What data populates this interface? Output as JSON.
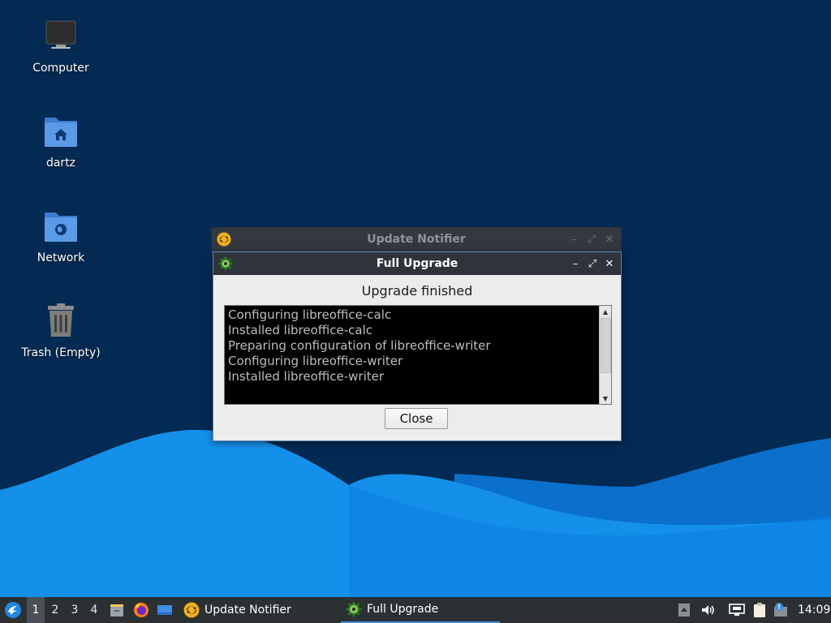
{
  "desktop": {
    "icons": [
      {
        "label": "Computer",
        "icon": "computer-icon"
      },
      {
        "label": "dartz",
        "icon": "home-folder-icon"
      },
      {
        "label": "Network",
        "icon": "network-folder-icon"
      },
      {
        "label": "Trash (Empty)",
        "icon": "trash-icon"
      }
    ]
  },
  "background_window": {
    "title": "Update Notifier",
    "icon": "update-notifier-icon",
    "buttons": {
      "minimize": "–",
      "maximize": "⤢",
      "close": "✕"
    }
  },
  "dialog": {
    "title": "Full Upgrade",
    "icon": "gear-icon",
    "buttons": {
      "minimize": "–",
      "maximize": "⤢",
      "close": "✕"
    },
    "status": "Upgrade finished",
    "log": [
      "Configuring libreoffice-calc",
      "Installed libreoffice-calc",
      "Preparing configuration of libreoffice-writer",
      "Configuring libreoffice-writer",
      "Installed libreoffice-writer"
    ],
    "close_label": "Close"
  },
  "taskbar": {
    "workspaces": [
      "1",
      "2",
      "3",
      "4"
    ],
    "active_workspace": "1",
    "tasks": [
      {
        "label": "Update Notifier",
        "icon": "update-notifier-icon"
      },
      {
        "label": "Full Upgrade",
        "icon": "gear-icon"
      }
    ],
    "clock": "14:09"
  },
  "colors": {
    "desktop_background": "#022a52",
    "wave_light": "#1590ea",
    "wave_mid": "#0a76d6",
    "taskbar": "#2b3033",
    "titlebar": "#2f343a",
    "log_background": "#000000",
    "log_text": "#bdbdbd"
  }
}
